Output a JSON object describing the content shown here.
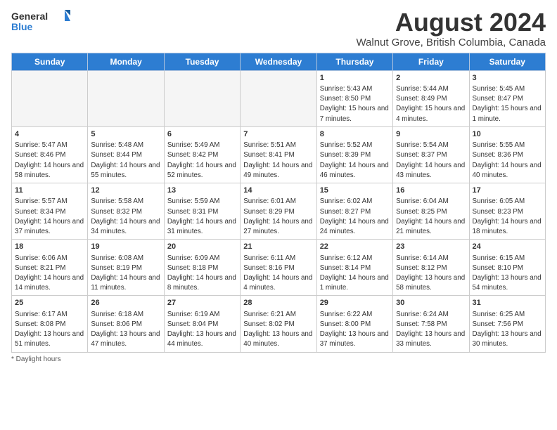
{
  "header": {
    "logo_line1": "General",
    "logo_line2": "Blue",
    "main_title": "August 2024",
    "subtitle": "Walnut Grove, British Columbia, Canada"
  },
  "days_of_week": [
    "Sunday",
    "Monday",
    "Tuesday",
    "Wednesday",
    "Thursday",
    "Friday",
    "Saturday"
  ],
  "weeks": [
    [
      {
        "day": "",
        "info": "",
        "empty": true
      },
      {
        "day": "",
        "info": "",
        "empty": true
      },
      {
        "day": "",
        "info": "",
        "empty": true
      },
      {
        "day": "",
        "info": "",
        "empty": true
      },
      {
        "day": "1",
        "info": "Sunrise: 5:43 AM\nSunset: 8:50 PM\nDaylight: 15 hours\nand 7 minutes."
      },
      {
        "day": "2",
        "info": "Sunrise: 5:44 AM\nSunset: 8:49 PM\nDaylight: 15 hours\nand 4 minutes."
      },
      {
        "day": "3",
        "info": "Sunrise: 5:45 AM\nSunset: 8:47 PM\nDaylight: 15 hours\nand 1 minute."
      }
    ],
    [
      {
        "day": "4",
        "info": "Sunrise: 5:47 AM\nSunset: 8:46 PM\nDaylight: 14 hours\nand 58 minutes."
      },
      {
        "day": "5",
        "info": "Sunrise: 5:48 AM\nSunset: 8:44 PM\nDaylight: 14 hours\nand 55 minutes."
      },
      {
        "day": "6",
        "info": "Sunrise: 5:49 AM\nSunset: 8:42 PM\nDaylight: 14 hours\nand 52 minutes."
      },
      {
        "day": "7",
        "info": "Sunrise: 5:51 AM\nSunset: 8:41 PM\nDaylight: 14 hours\nand 49 minutes."
      },
      {
        "day": "8",
        "info": "Sunrise: 5:52 AM\nSunset: 8:39 PM\nDaylight: 14 hours\nand 46 minutes."
      },
      {
        "day": "9",
        "info": "Sunrise: 5:54 AM\nSunset: 8:37 PM\nDaylight: 14 hours\nand 43 minutes."
      },
      {
        "day": "10",
        "info": "Sunrise: 5:55 AM\nSunset: 8:36 PM\nDaylight: 14 hours\nand 40 minutes."
      }
    ],
    [
      {
        "day": "11",
        "info": "Sunrise: 5:57 AM\nSunset: 8:34 PM\nDaylight: 14 hours\nand 37 minutes."
      },
      {
        "day": "12",
        "info": "Sunrise: 5:58 AM\nSunset: 8:32 PM\nDaylight: 14 hours\nand 34 minutes."
      },
      {
        "day": "13",
        "info": "Sunrise: 5:59 AM\nSunset: 8:31 PM\nDaylight: 14 hours\nand 31 minutes."
      },
      {
        "day": "14",
        "info": "Sunrise: 6:01 AM\nSunset: 8:29 PM\nDaylight: 14 hours\nand 27 minutes."
      },
      {
        "day": "15",
        "info": "Sunrise: 6:02 AM\nSunset: 8:27 PM\nDaylight: 14 hours\nand 24 minutes."
      },
      {
        "day": "16",
        "info": "Sunrise: 6:04 AM\nSunset: 8:25 PM\nDaylight: 14 hours\nand 21 minutes."
      },
      {
        "day": "17",
        "info": "Sunrise: 6:05 AM\nSunset: 8:23 PM\nDaylight: 14 hours\nand 18 minutes."
      }
    ],
    [
      {
        "day": "18",
        "info": "Sunrise: 6:06 AM\nSunset: 8:21 PM\nDaylight: 14 hours\nand 14 minutes."
      },
      {
        "day": "19",
        "info": "Sunrise: 6:08 AM\nSunset: 8:19 PM\nDaylight: 14 hours\nand 11 minutes."
      },
      {
        "day": "20",
        "info": "Sunrise: 6:09 AM\nSunset: 8:18 PM\nDaylight: 14 hours\nand 8 minutes."
      },
      {
        "day": "21",
        "info": "Sunrise: 6:11 AM\nSunset: 8:16 PM\nDaylight: 14 hours\nand 4 minutes."
      },
      {
        "day": "22",
        "info": "Sunrise: 6:12 AM\nSunset: 8:14 PM\nDaylight: 14 hours\nand 1 minute."
      },
      {
        "day": "23",
        "info": "Sunrise: 6:14 AM\nSunset: 8:12 PM\nDaylight: 13 hours\nand 58 minutes."
      },
      {
        "day": "24",
        "info": "Sunrise: 6:15 AM\nSunset: 8:10 PM\nDaylight: 13 hours\nand 54 minutes."
      }
    ],
    [
      {
        "day": "25",
        "info": "Sunrise: 6:17 AM\nSunset: 8:08 PM\nDaylight: 13 hours\nand 51 minutes."
      },
      {
        "day": "26",
        "info": "Sunrise: 6:18 AM\nSunset: 8:06 PM\nDaylight: 13 hours\nand 47 minutes."
      },
      {
        "day": "27",
        "info": "Sunrise: 6:19 AM\nSunset: 8:04 PM\nDaylight: 13 hours\nand 44 minutes."
      },
      {
        "day": "28",
        "info": "Sunrise: 6:21 AM\nSunset: 8:02 PM\nDaylight: 13 hours\nand 40 minutes."
      },
      {
        "day": "29",
        "info": "Sunrise: 6:22 AM\nSunset: 8:00 PM\nDaylight: 13 hours\nand 37 minutes."
      },
      {
        "day": "30",
        "info": "Sunrise: 6:24 AM\nSunset: 7:58 PM\nDaylight: 13 hours\nand 33 minutes."
      },
      {
        "day": "31",
        "info": "Sunrise: 6:25 AM\nSunset: 7:56 PM\nDaylight: 13 hours\nand 30 minutes."
      }
    ]
  ],
  "footer": {
    "note": "Daylight hours"
  }
}
